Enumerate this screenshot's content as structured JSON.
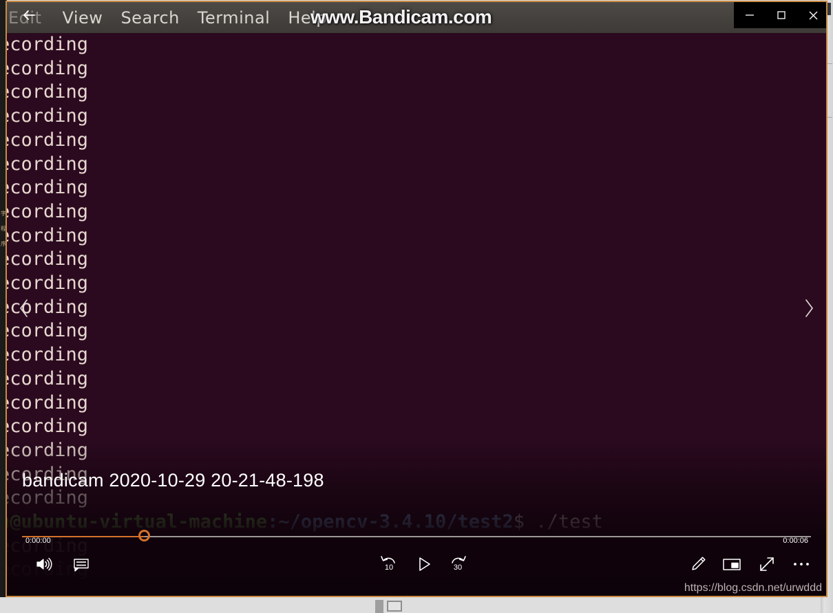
{
  "window": {
    "back_icon": "back-arrow-icon",
    "minimize_label": "—",
    "maximize_label": "□",
    "close_label": "✕"
  },
  "terminal": {
    "menu": [
      "Edit",
      "View",
      "Search",
      "Terminal",
      "Help"
    ],
    "output_line": "ecording",
    "output_line_count": 22,
    "prompt_user": "u@ubuntu-virtual-machine",
    "prompt_sep": ":",
    "prompt_path": "~/opencv-3.4.10/test2",
    "prompt_symbol": "$",
    "prompt_command": " ./test"
  },
  "watermarks": {
    "bandicam": "www.Bandicam.com",
    "csdn": "https://blog.csdn.net/urwddd"
  },
  "player": {
    "title": "bandicam 2020-10-29 20-21-48-198",
    "time_current": "0:00:00",
    "time_total": "0:00:06",
    "progress_percent": 15.5,
    "accent_color": "#d4722a",
    "prev_icon": "chevron-left-icon",
    "next_icon": "chevron-right-icon",
    "controls": {
      "volume_icon": "volume-icon",
      "captions_icon": "closed-captions-icon",
      "rewind_label": "10",
      "play_icon": "play-icon",
      "forward_label": "30",
      "edit_icon": "pencil-edit-icon",
      "miniplayer_icon": "mini-player-icon",
      "fullscreen_icon": "fullscreen-icon",
      "more_icon": "more-options-icon"
    }
  },
  "background": {
    "side_glyphs": "字\n程\n序"
  }
}
